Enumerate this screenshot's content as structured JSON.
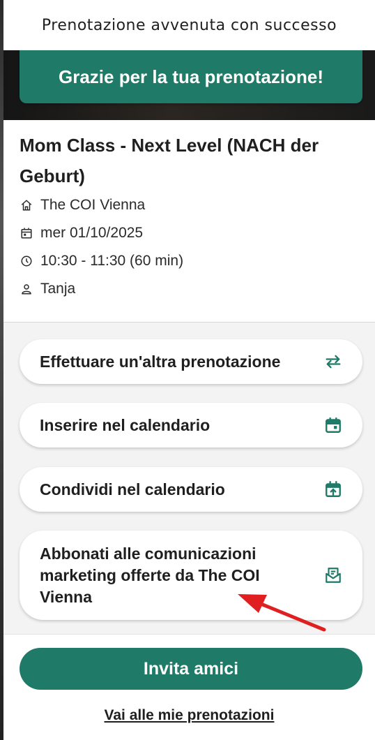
{
  "header": {
    "title": "Prenotazione avvenuta con successo"
  },
  "banner": {
    "text": "Grazie per la tua prenotazione!"
  },
  "class_info": {
    "title": "Mom Class - Next Level (NACH der Geburt)",
    "location": "The COI Vienna",
    "date": "mer 01/10/2025",
    "time": "10:30 - 11:30 (60 min)",
    "instructor": "Tanja"
  },
  "actions": [
    {
      "label": "Effettuare un'altra prenotazione",
      "icon": "repeat-icon"
    },
    {
      "label": "Inserire nel calendario",
      "icon": "calendar-icon"
    },
    {
      "label": "Condividi nel calendario",
      "icon": "calendar-share-icon"
    },
    {
      "label": "Abbonati alle comunicazioni marketing offerte da The COI Vienna",
      "icon": "mail-subscribe-icon"
    }
  ],
  "footer": {
    "invite_label": "Invita amici",
    "bookings_link": "Vai alle mie prenotazioni"
  },
  "colors": {
    "accent": "#1f7a68",
    "annotation": "#e02020"
  }
}
